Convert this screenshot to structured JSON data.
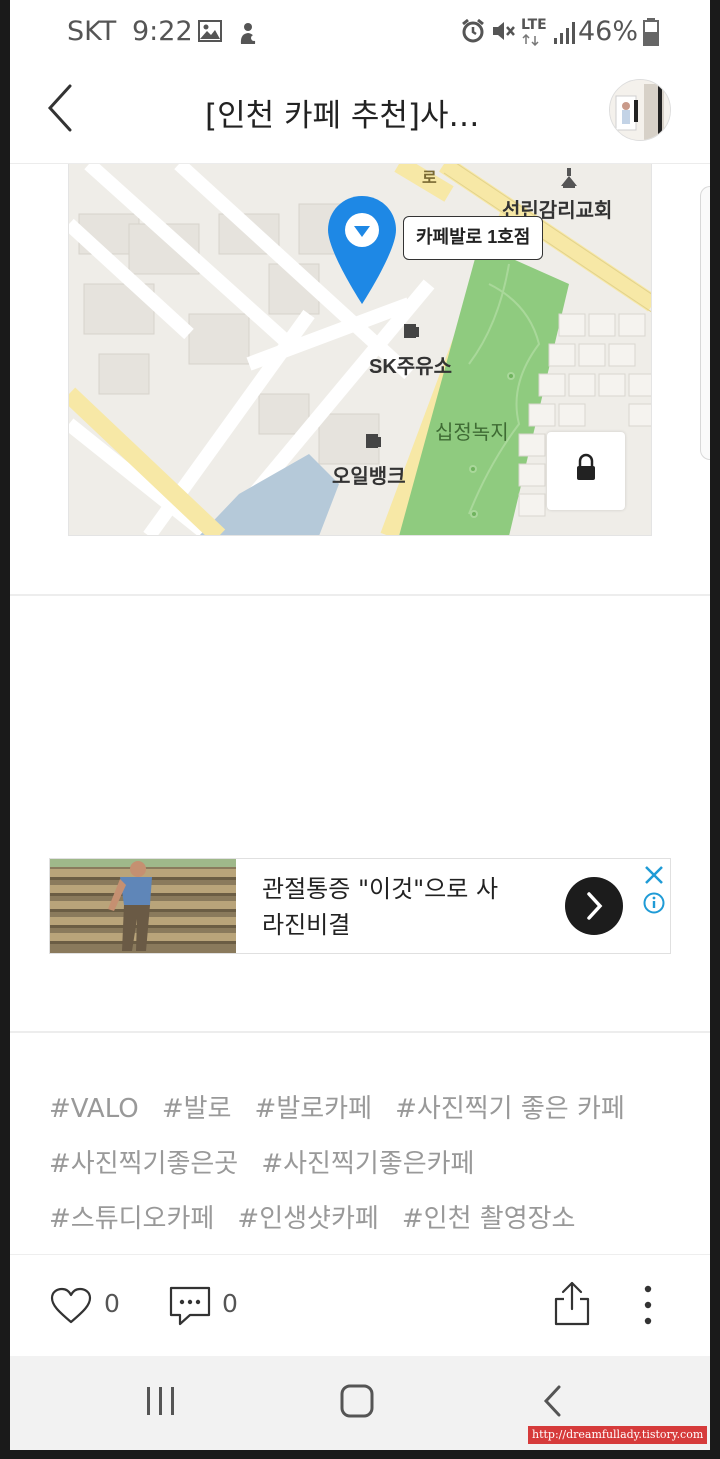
{
  "status_bar": {
    "carrier": "SKT",
    "time": "9:22",
    "network": "LTE",
    "battery": "46%"
  },
  "header": {
    "title": "[인천 카페 추천]사…",
    "back_icon": "chevron-left-icon",
    "avatar_icon": "profile-photo"
  },
  "map": {
    "callout": "카페발로 1호점",
    "labels": {
      "church": "선린감리교회",
      "gas_station": "SK주유소",
      "park": "십정녹지",
      "oil_bank": "오일뱅크",
      "road": "로"
    },
    "colors": {
      "pin": "#1e88e5",
      "park": "#8fcb7f",
      "road": "#f7e8a6",
      "water": "#b5c9d9"
    }
  },
  "ad": {
    "text": "관절통증 \"이것\"으로 사라진비결",
    "arrow_icon": "chevron-right-icon",
    "close_icon": "close-icon",
    "info_icon": "info-icon"
  },
  "tags": [
    [
      "#VALO",
      "#발로",
      "#발로카페",
      "#사진찍기 좋은 카페"
    ],
    [
      "#사진찍기좋은곳",
      "#사진찍기좋은카페"
    ],
    [
      "#스튜디오카페",
      "#인생샷카페",
      "#인천 촬영장소"
    ]
  ],
  "actions": {
    "like_count": "0",
    "comment_count": "0",
    "like_icon": "heart-icon",
    "comment_icon": "comment-icon",
    "share_icon": "share-icon",
    "more_icon": "more-vertical-icon"
  },
  "nav": {
    "recent_icon": "recent-apps-icon",
    "home_icon": "home-icon",
    "back_icon": "back-icon"
  },
  "watermark": "http://dreamfullady.tistory.com"
}
